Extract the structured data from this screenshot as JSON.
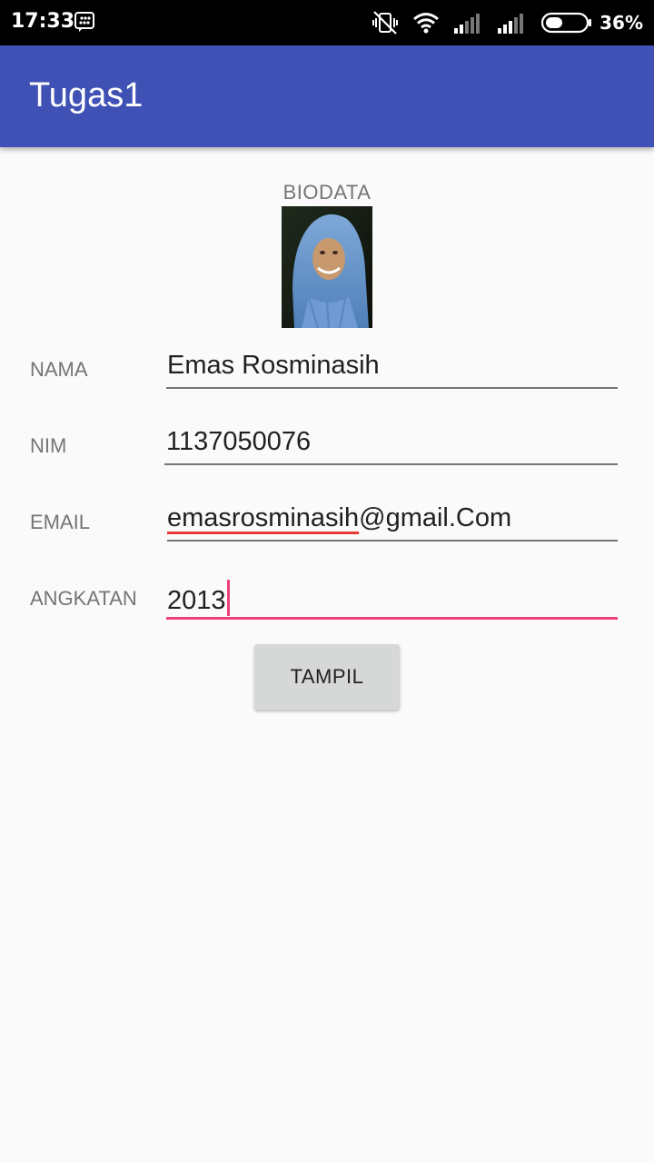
{
  "status_bar": {
    "time": "17:33",
    "battery_percent": "36%",
    "icons": [
      "bbm-notification-icon",
      "vibrate-off-icon",
      "wifi-icon",
      "signal-icon",
      "signal-icon",
      "battery-icon"
    ]
  },
  "app_bar": {
    "title": "Tugas1",
    "color": "#3f51b5"
  },
  "content": {
    "header": "BIODATA",
    "photo_alt": "profile-photo",
    "fields": {
      "nama": {
        "label": "NAMA",
        "value": "Emas Rosminasih"
      },
      "nim": {
        "label": "NIM",
        "value": "1137050076"
      },
      "email": {
        "label": "EMAIL",
        "value_user": "emasrosminasih",
        "value_domain": "@gmail.Com"
      },
      "angkatan": {
        "label": "ANGKATAN",
        "value": "2013"
      }
    },
    "button_label": "TAMPIL"
  },
  "colors": {
    "accent": "#ec407a",
    "background": "#fafafa",
    "button": "#d6d7d7"
  }
}
